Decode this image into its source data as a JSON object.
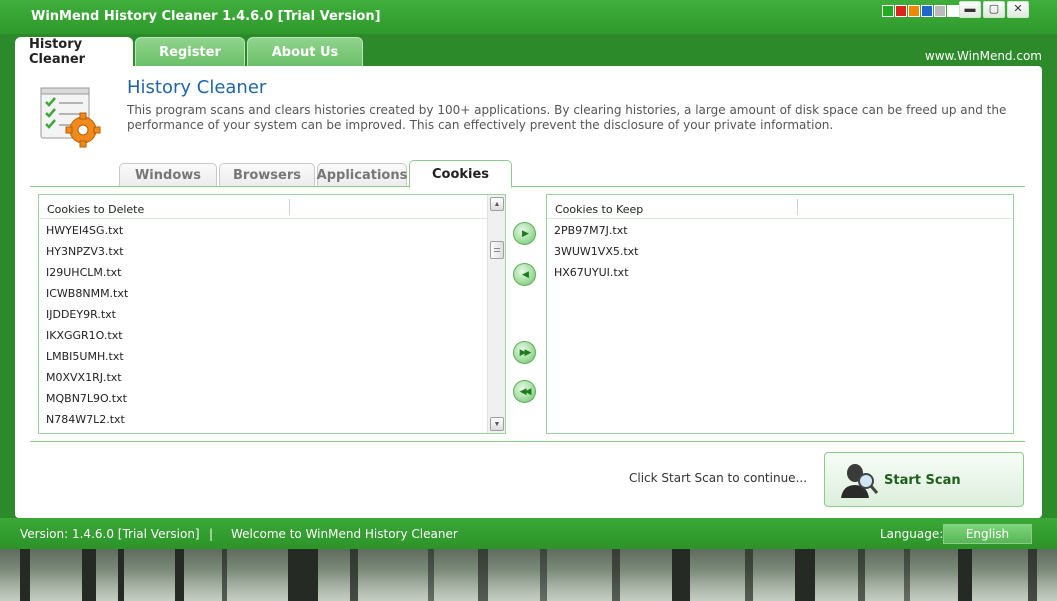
{
  "window": {
    "title": "WinMend History Cleaner 1.4.6.0 [Trial Version]",
    "skin_colors": [
      "#22aa22",
      "#dd2222",
      "#ee8800",
      "#2266cc",
      "#bbbbbb",
      "#ffffff"
    ],
    "minimize": "▬",
    "maximize": "▢",
    "close": "✕"
  },
  "main_tabs": [
    {
      "label": "History Cleaner",
      "active": true
    },
    {
      "label": "Register",
      "active": false
    },
    {
      "label": "About Us",
      "active": false
    }
  ],
  "site": "www.WinMend.com",
  "section": {
    "title": "History Cleaner",
    "description": "This program scans and clears histories created by 100+ applications. By clearing histories, a large amount of disk space can be freed up and the performance of your system can be improved. This can effectively prevent the disclosure of your private information."
  },
  "sub_tabs": [
    {
      "label": "Windows",
      "active": false
    },
    {
      "label": "Browsers",
      "active": false
    },
    {
      "label": "Applications",
      "active": false
    },
    {
      "label": "Cookies",
      "active": true
    }
  ],
  "delete_list": {
    "header": "Cookies to Delete",
    "items": [
      "HWYEI4SG.txt",
      "HY3NPZV3.txt",
      "I29UHCLM.txt",
      "ICWB8NMM.txt",
      "IJDDEY9R.txt",
      "IKXGGR1O.txt",
      "LMBI5UMH.txt",
      "M0XVX1RJ.txt",
      "MQBN7L9O.txt",
      "N784W7L2.txt"
    ]
  },
  "keep_list": {
    "header": "Cookies to Keep",
    "items": [
      "2PB97M7J.txt",
      "3WUW1VX5.txt",
      "HX67UYUI.txt"
    ]
  },
  "move_buttons": {
    "right": "▶",
    "left": "◀",
    "all_right": "▶▶",
    "all_left": "◀◀"
  },
  "scroll": {
    "up": "▲",
    "down": "▼"
  },
  "hint": "Click Start Scan to continue...",
  "start_scan": "Start Scan",
  "status": {
    "version": "Version:  1.4.6.0 [Trial Version]",
    "separator": "|",
    "welcome": "Welcome to WinMend History Cleaner",
    "language_label": "Language:",
    "language_value": "English"
  },
  "icons": [
    "checklist-gear-icon",
    "scan-person-magnifier-icon"
  ]
}
